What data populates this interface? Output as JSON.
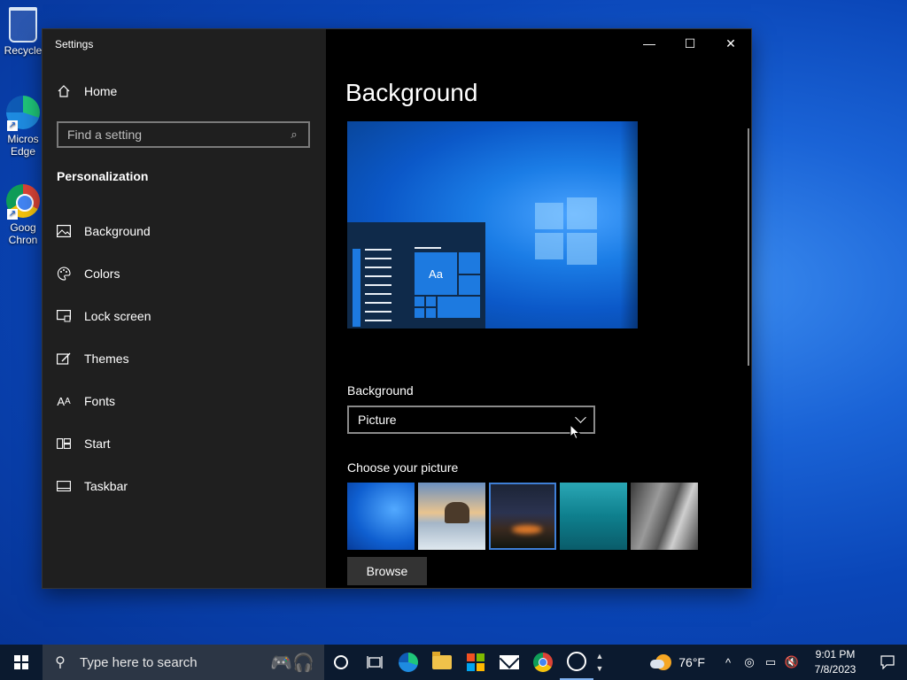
{
  "desktop": {
    "icons": [
      {
        "label": "Recycle"
      },
      {
        "label": "Micros Edge"
      },
      {
        "label": "Goog Chron"
      }
    ]
  },
  "window": {
    "title": "Settings",
    "minimize_glyph": "—",
    "maximize_glyph": "☐",
    "close_glyph": "✕"
  },
  "sidebar": {
    "home_label": "Home",
    "search_placeholder": "Find a setting",
    "section_title": "Personalization",
    "items": [
      {
        "label": "Background",
        "icon": "image-icon"
      },
      {
        "label": "Colors",
        "icon": "palette-icon"
      },
      {
        "label": "Lock screen",
        "icon": "lock-screen-icon"
      },
      {
        "label": "Themes",
        "icon": "themes-icon"
      },
      {
        "label": "Fonts",
        "icon": "fonts-icon"
      },
      {
        "label": "Start",
        "icon": "start-icon"
      },
      {
        "label": "Taskbar",
        "icon": "taskbar-icon"
      }
    ]
  },
  "main": {
    "title": "Background",
    "preview_tile_label": "Aa",
    "dropdown_label": "Background",
    "dropdown_value": "Picture",
    "choose_label": "Choose your picture",
    "browse_label": "Browse"
  },
  "taskbar": {
    "search_placeholder": "Type here to search",
    "weather_temp": "76°F",
    "time": "9:01 PM",
    "date": "7/8/2023"
  },
  "colors": {
    "accent": "#3f7fd6",
    "sidebar_bg": "#1f1f1f",
    "content_bg": "#000000",
    "taskbar_bg": "#0b1a2f"
  }
}
